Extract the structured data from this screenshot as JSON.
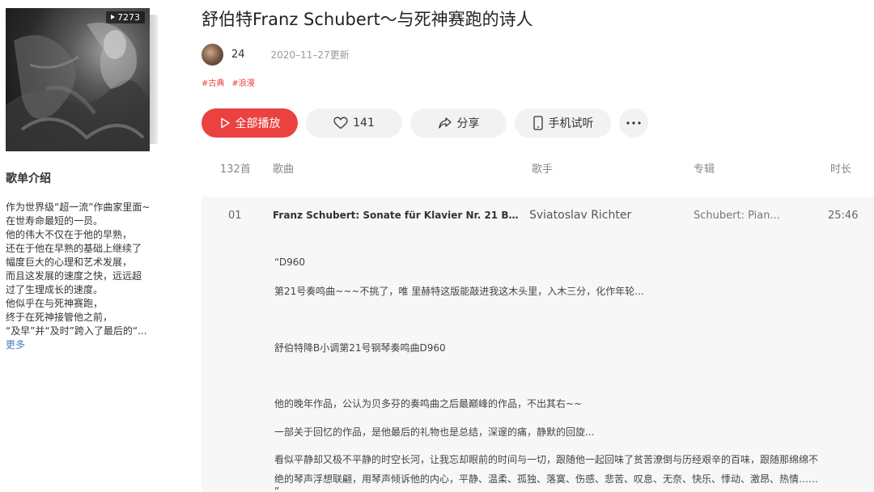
{
  "playlist": {
    "title": "舒伯特Franz Schubert～与死神赛跑的诗人",
    "play_count": "7273",
    "creator_name": "24",
    "update_date": "2020–11–27更新",
    "tags": [
      "#古典",
      "#浪漫"
    ]
  },
  "actions": {
    "play_all": "全部播放",
    "like_count": "141",
    "share": "分享",
    "phone_trial": "手机试听",
    "more": "···"
  },
  "intro": {
    "title": "歌单介绍",
    "lines": [
      "作为世界级“超一流”作曲家里面~",
      "在世寿命最短的一员。",
      "他的伟大不仅在于他的早熟，",
      "还在于他在早熟的基础上继续了",
      "幅度巨大的心理和艺术发展，",
      "而且这发展的速度之快，远远超",
      "过了生理成长的速度。",
      "他似乎在与死神赛跑，",
      "终于在死神接管他之前，",
      "“及早”并“及时”跨入了最后的“..."
    ],
    "more": "更多"
  },
  "table": {
    "headers": {
      "count": "132首",
      "song": "歌曲",
      "artist": "歌手",
      "album": "专辑",
      "duration": "时长"
    },
    "row": {
      "index": "01",
      "song": "Franz Schubert: Sonate für Klavier Nr. 21 B–Dur...",
      "artist": "Sviatoslav Richter",
      "album": "Schubert: Pian...",
      "duration": "25:46"
    },
    "description": [
      "“D960",
      "第21号奏鸣曲~~~不挑了，唯 里赫特这版能敲进我这木头里，入木三分，化作年轮...",
      "舒伯特降B小调第21号钢琴奏鸣曲D960",
      "他的晚年作品，公认为贝多芬的奏鸣曲之后最巅峰的作品，不出其右~~",
      "一部关于回忆的作品，是他最后的礼物也是总结，深邃的痛，静默的回旋...",
      "看似平静却又极不平静的时空长河，让我忘却眼前的时间与一切，跟随他一起回味了贫苦潦倒与历经艰辛的百味，跟随那绵绵不",
      "绝的琴声浮想联翩，用琴声倾诉他的内心，平静、温柔、孤独、落寞、伤感、悲苦、叹息、无奈、快乐、悸动、激昂、热情……",
      "”"
    ]
  },
  "colors": {
    "accent": "#ec4141",
    "button_bg": "#f2f2f2",
    "row_bg": "#f7f7f7",
    "link": "#4a7fbe"
  }
}
